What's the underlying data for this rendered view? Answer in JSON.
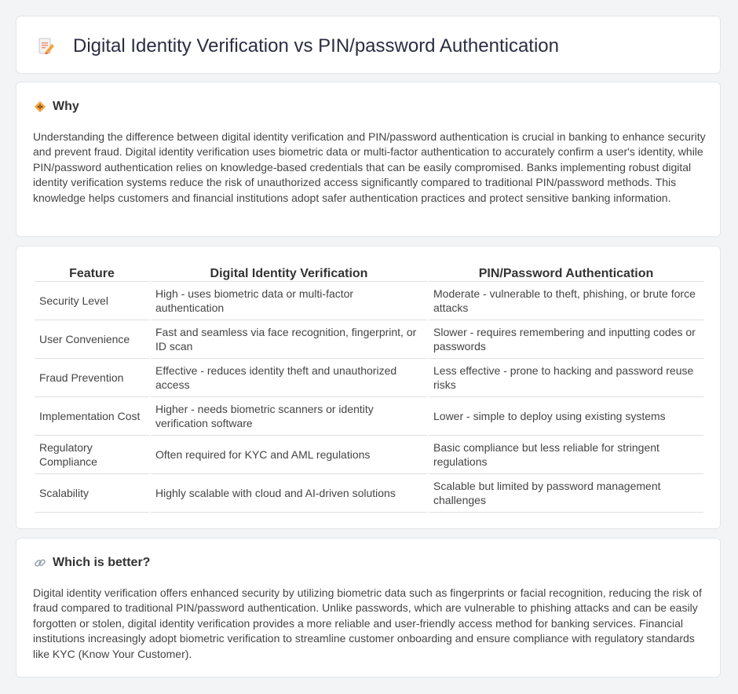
{
  "header": {
    "title": "Digital Identity Verification vs PIN/password Authentication",
    "icon": "document-pencil-icon"
  },
  "why": {
    "heading": "Why",
    "icon": "diamond-sign-icon",
    "text": "Understanding the difference between digital identity verification and PIN/password authentication is crucial in banking to enhance security and prevent fraud. Digital identity verification uses biometric data or multi-factor authentication to accurately confirm a user's identity, while PIN/password authentication relies on knowledge-based credentials that can be easily compromised. Banks implementing robust digital identity verification systems reduce the risk of unauthorized access significantly compared to traditional PIN/password methods. This knowledge helps customers and financial institutions adopt safer authentication practices and protect sensitive banking information."
  },
  "table": {
    "headers": [
      "Feature",
      "Digital Identity Verification",
      "PIN/Password Authentication"
    ],
    "rows": [
      [
        "Security Level",
        "High - uses biometric data or multi-factor authentication",
        "Moderate - vulnerable to theft, phishing, or brute force attacks"
      ],
      [
        "User Convenience",
        "Fast and seamless via face recognition, fingerprint, or ID scan",
        "Slower - requires remembering and inputting codes or passwords"
      ],
      [
        "Fraud Prevention",
        "Effective - reduces identity theft and unauthorized access",
        "Less effective - prone to hacking and password reuse risks"
      ],
      [
        "Implementation Cost",
        "Higher - needs biometric scanners or identity verification software",
        "Lower - simple to deploy using existing systems"
      ],
      [
        "Regulatory Compliance",
        "Often required for KYC and AML regulations",
        "Basic compliance but less reliable for stringent regulations"
      ],
      [
        "Scalability",
        "Highly scalable with cloud and AI-driven solutions",
        "Scalable but limited by password management challenges"
      ]
    ]
  },
  "better": {
    "heading": "Which is better?",
    "icon": "link-icon",
    "text": "Digital identity verification offers enhanced security by utilizing biometric data such as fingerprints or facial recognition, reducing the risk of fraud compared to traditional PIN/password authentication. Unlike passwords, which are vulnerable to phishing attacks and can be easily forgotten or stolen, digital identity verification provides a more reliable and user-friendly access method for banking services. Financial institutions increasingly adopt biometric verification to streamline customer onboarding and ensure compliance with regulatory standards like KYC (Know Your Customer)."
  }
}
